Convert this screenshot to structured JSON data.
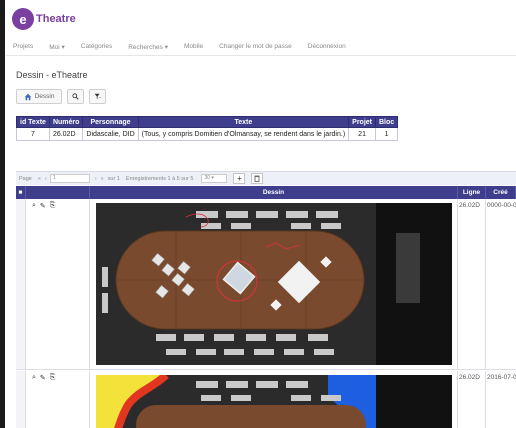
{
  "logo": {
    "mark": "e",
    "text": "Theatre"
  },
  "menu": [
    "Projets",
    "Moi ▾",
    "Catégories",
    "Recherches ▾",
    "Mobile",
    "Changer le mot de passe",
    "Déconnexion"
  ],
  "page_title": "Dessin - eTheatre",
  "toolbar": {
    "home_label": "Dessin"
  },
  "meta_table": {
    "headers": [
      "id Texte",
      "Numéro",
      "Personnage",
      "Texte",
      "Projet",
      "Bloc"
    ],
    "row": [
      "7",
      "26.02D",
      "Didascalie, DID",
      "(Tous, y compris Domitien d'Olmansay, se rendent dans le jardin.)",
      "21",
      "1"
    ]
  },
  "pager": {
    "page_label": "Page",
    "page_value": "1",
    "of_label": "sur 1",
    "records_label": "Enregistrements 1 à 5 sur 5",
    "per_page": "30"
  },
  "grid": {
    "headers": {
      "dessin": "Dessin",
      "ligne": "Ligne",
      "cree": "Créé"
    },
    "rows": [
      {
        "ligne": "26.02D",
        "cree": "0000-00-0"
      },
      {
        "ligne": "26.02D",
        "cree": "2016-07-0"
      }
    ]
  },
  "colors": {
    "header_bg": "#3e3e8c",
    "brand": "#7a3fa0",
    "stage_table": "#7a4a2e"
  }
}
